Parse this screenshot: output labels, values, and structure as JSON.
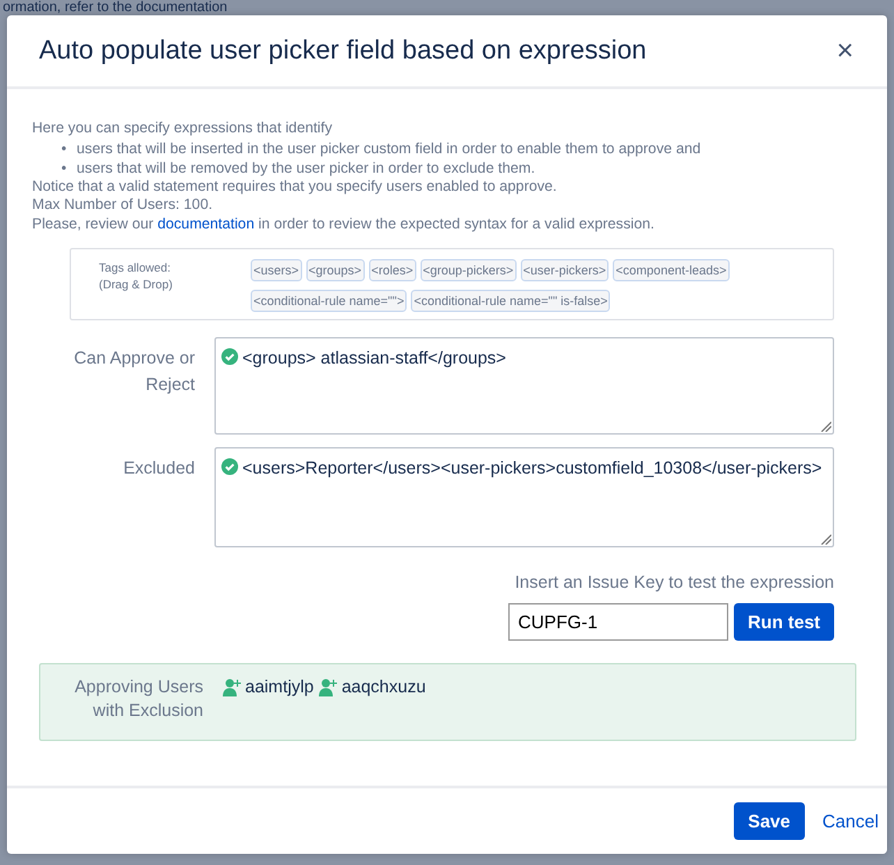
{
  "backdrop_text": "ormation, refer to the documentation",
  "dialog": {
    "title": "Auto populate user picker field based on expression",
    "close": "×"
  },
  "intro": {
    "lead": "Here you can specify expressions that identify",
    "bullets": [
      {
        "marker": "•",
        "text": "users that will be inserted in the user picker custom field in order to enable them to approve and"
      },
      {
        "marker": "•",
        "text": "users that will be removed by the user picker in order to exclude them."
      }
    ],
    "notice": "Notice that a valid statement requires that you specify users enabled to approve.",
    "max_users": "Max Number of Users: 100.",
    "review_before": "Please, review our",
    "review_link": "documentation",
    "review_after": "in order to review the expected syntax for a valid expression."
  },
  "tags": {
    "label": "Tags allowed: (Drag & Drop)",
    "items": [
      "<users>",
      "<groups>",
      "<roles>",
      "<group-pickers>",
      "<user-pickers>",
      "<component-leads>",
      "<conditional-rule name=\"\">",
      "<conditional-rule name=\"\" is-false>"
    ]
  },
  "fields": [
    {
      "label": "Can Approve or Reject",
      "value": "<groups> atlassian-staff</groups>",
      "valid": true
    },
    {
      "label": "Excluded",
      "value": "<users>Reporter</users><user-pickers>customfield_10308</user-pickers>",
      "valid": true
    }
  ],
  "test": {
    "label": "Insert an Issue Key to test the expression",
    "value": "CUPFG-1",
    "button": "Run test"
  },
  "result": {
    "label": "Approving Users with Exclusion",
    "users": [
      "aaimtjylp",
      "aaqchxuzu"
    ]
  },
  "footer": {
    "save": "Save",
    "cancel": "Cancel"
  }
}
